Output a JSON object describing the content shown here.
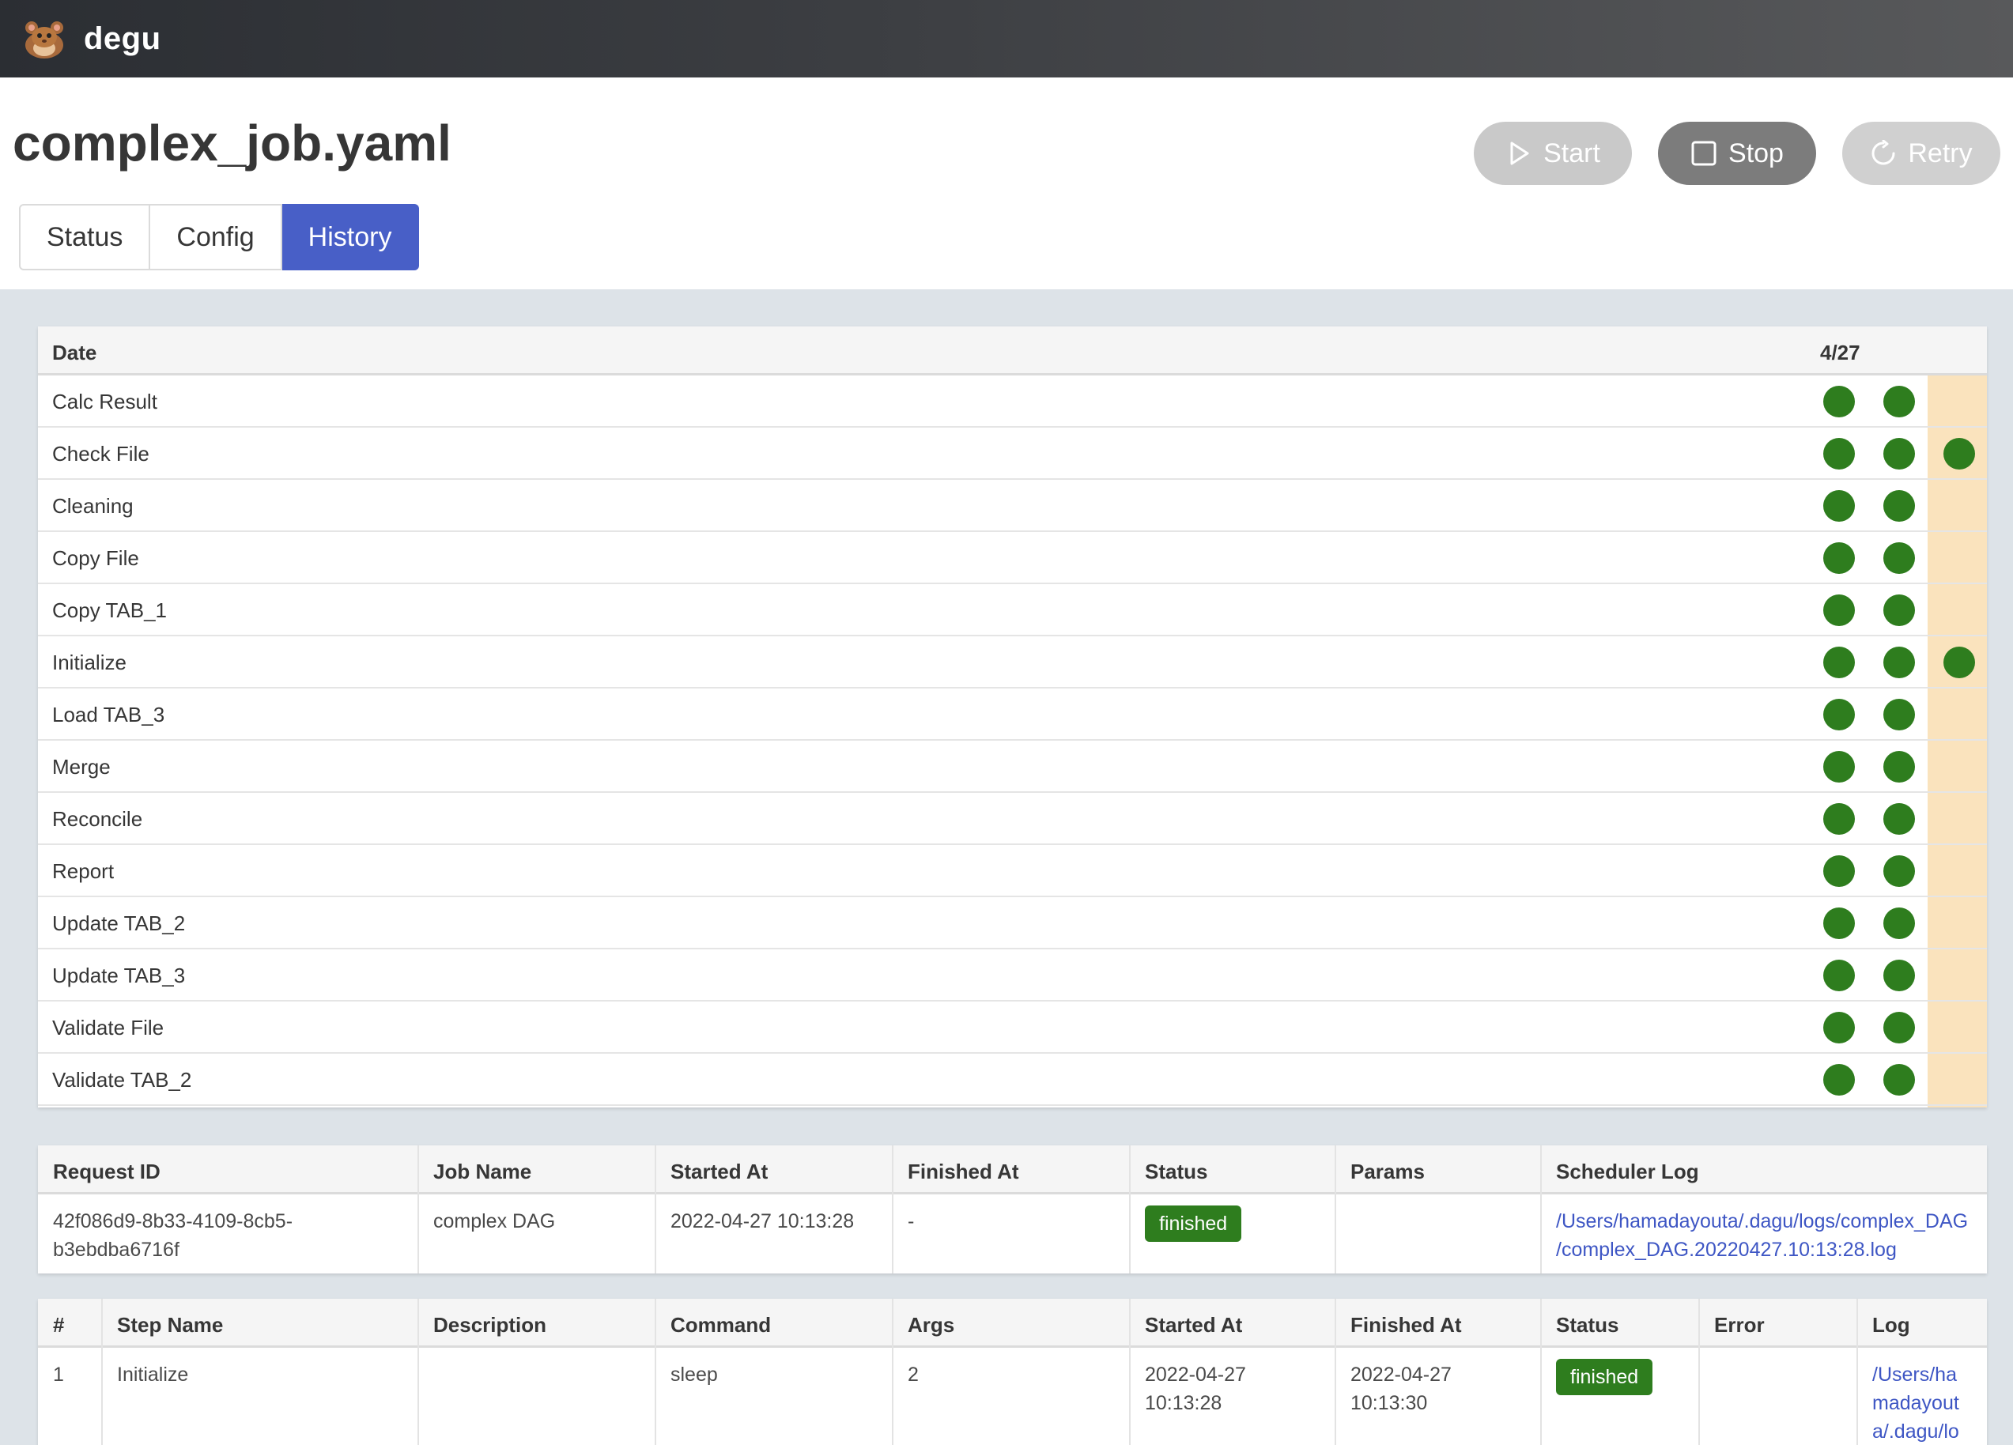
{
  "app": {
    "brand": "degu",
    "logo_icon": "degu-logo-icon"
  },
  "page": {
    "title": "complex_job.yaml"
  },
  "actions": {
    "start": "Start",
    "stop": "Stop",
    "retry": "Retry"
  },
  "tabs": [
    "Status",
    "Config",
    "History"
  ],
  "active_tab": "History",
  "history": {
    "header_label": "Date",
    "date_label": "4/27",
    "highlight_color": "#fae3bd",
    "status_color": "#2e7d1e",
    "rows": [
      {
        "name": "Calc Result",
        "runs": [
          1,
          1,
          0
        ]
      },
      {
        "name": "Check File",
        "runs": [
          1,
          1,
          1
        ]
      },
      {
        "name": "Cleaning",
        "runs": [
          1,
          1,
          0
        ]
      },
      {
        "name": "Copy File",
        "runs": [
          1,
          1,
          0
        ]
      },
      {
        "name": "Copy TAB_1",
        "runs": [
          1,
          1,
          0
        ]
      },
      {
        "name": "Initialize",
        "runs": [
          1,
          1,
          1
        ]
      },
      {
        "name": "Load TAB_3",
        "runs": [
          1,
          1,
          0
        ]
      },
      {
        "name": "Merge",
        "runs": [
          1,
          1,
          0
        ]
      },
      {
        "name": "Reconcile",
        "runs": [
          1,
          1,
          0
        ]
      },
      {
        "name": "Report",
        "runs": [
          1,
          1,
          0
        ]
      },
      {
        "name": "Update TAB_2",
        "runs": [
          1,
          1,
          0
        ]
      },
      {
        "name": "Update TAB_3",
        "runs": [
          1,
          1,
          0
        ]
      },
      {
        "name": "Validate File",
        "runs": [
          1,
          1,
          0
        ]
      },
      {
        "name": "Validate TAB_2",
        "runs": [
          1,
          1,
          0
        ]
      }
    ]
  },
  "request": {
    "headers": [
      "Request ID",
      "Job Name",
      "Started At",
      "Finished At",
      "Status",
      "Params",
      "Scheduler Log"
    ],
    "row": {
      "request_id_1": "42f086d9-8b33-4109-8cb5-",
      "request_id_2": "b3ebdba6716f",
      "job_name": "complex DAG",
      "started_at": "2022-04-27 10:13:28",
      "finished_at": "-",
      "status": "finished",
      "params": "",
      "log_1": "/Users/hamadayouta/.dagu/logs/complex_DAG",
      "log_2": "/complex_DAG.20220427.10:13:28.log"
    }
  },
  "steps": {
    "headers": [
      "#",
      "Step Name",
      "Description",
      "Command",
      "Args",
      "Started At",
      "Finished At",
      "Status",
      "Error",
      "Log"
    ],
    "row": {
      "num": "1",
      "name": "Initialize",
      "description": "",
      "command": "sleep",
      "args": "2",
      "started_1": "2022-04-27",
      "started_2": "10:13:28",
      "finished_1": "2022-04-27",
      "finished_2": "10:13:30",
      "status": "finished",
      "error": "",
      "log_1": "/Users/ha",
      "log_2": "madayout",
      "log_3": "a/.dagu/lo"
    }
  }
}
